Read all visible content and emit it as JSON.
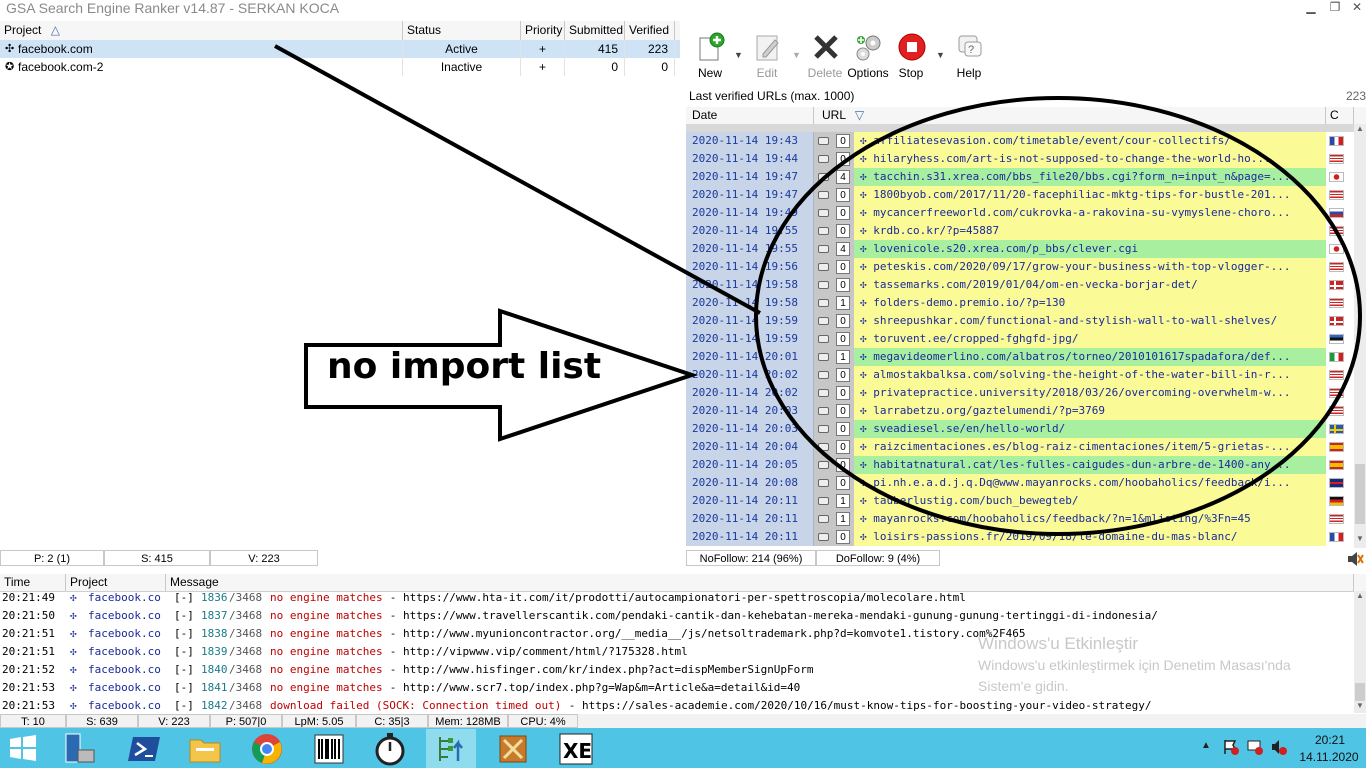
{
  "window": {
    "title": "GSA Search Engine Ranker v14.87 - SERKAN KOCA",
    "min_icon": "minimize-icon",
    "max_icon": "maximize-icon"
  },
  "projects": {
    "headers": {
      "project": "Project",
      "status": "Status",
      "priority": "Priority",
      "submitted": "Submitted",
      "verified": "Verified"
    },
    "rows": [
      {
        "name": "facebook.com",
        "status": "Active",
        "priority": "+",
        "submitted": "415",
        "verified": "223"
      },
      {
        "name": "facebook.com-2",
        "status": "Inactive",
        "priority": "+",
        "submitted": "0",
        "verified": "0"
      }
    ],
    "status_bar": {
      "p": "P: 2 (1)",
      "s": "S: 415",
      "v": "V: 223"
    }
  },
  "toolbar": {
    "new": "New",
    "edit": "Edit",
    "delete": "Delete",
    "options": "Options",
    "stop": "Stop",
    "help": "Help"
  },
  "verified": {
    "caption": "Last verified URLs (max. 1000)",
    "count": "223",
    "headers": {
      "date": "Date",
      "url": "URL",
      "c": "C"
    },
    "rows": [
      {
        "date": "2020-11-14 19:43",
        "n": "0",
        "url": "affiliatesevasion.com/timetable/event/cour-collectifs/",
        "flag": "fr",
        "hl": false
      },
      {
        "date": "2020-11-14 19:44",
        "n": "0",
        "url": "hilaryhess.com/art-is-not-supposed-to-change-the-world-ho...",
        "flag": "us",
        "hl": false
      },
      {
        "date": "2020-11-14 19:47",
        "n": "4",
        "url": "tacchin.s31.xrea.com/bbs_file20/bbs.cgi?form_n=input_n&page=...",
        "flag": "jp",
        "hl": true
      },
      {
        "date": "2020-11-14 19:47",
        "n": "0",
        "url": "1800byob.com/2017/11/20-facephiliac-mktg-tips-for-bustle-201...",
        "flag": "us",
        "hl": false
      },
      {
        "date": "2020-11-14 19:49",
        "n": "0",
        "url": "mycancerfreeworld.com/cukrovka-a-rakovina-su-vymyslene-choro...",
        "flag": "sk",
        "hl": false
      },
      {
        "date": "2020-11-14 19:55",
        "n": "0",
        "url": "krdb.co.kr/?p=45887",
        "flag": "us",
        "hl": false
      },
      {
        "date": "2020-11-14 19:55",
        "n": "4",
        "url": "lovenicole.s20.xrea.com/p_bbs/clever.cgi",
        "flag": "jp",
        "hl": true
      },
      {
        "date": "2020-11-14 19:56",
        "n": "0",
        "url": "peteskis.com/2020/09/17/grow-your-business-with-top-vlogger-...",
        "flag": "us",
        "hl": false
      },
      {
        "date": "2020-11-14 19:58",
        "n": "0",
        "url": "tassemarks.com/2019/01/04/om-en-vecka-borjar-det/",
        "flag": "dk",
        "hl": false
      },
      {
        "date": "2020-11-14 19:58",
        "n": "1",
        "url": "folders-demo.premio.io/?p=130",
        "flag": "us",
        "hl": false
      },
      {
        "date": "2020-11-14 19:59",
        "n": "0",
        "url": "shreepushkar.com/functional-and-stylish-wall-to-wall-shelves/",
        "flag": "dk",
        "hl": false
      },
      {
        "date": "2020-11-14 19:59",
        "n": "0",
        "url": "toruvent.ee/cropped-fghgfd-jpg/",
        "flag": "ee",
        "hl": false
      },
      {
        "date": "2020-11-14 20:01",
        "n": "1",
        "url": "megavideomerlino.com/albatros/torneo/2010101617spadafora/def...",
        "flag": "it",
        "hl": true
      },
      {
        "date": "2020-11-14 20:02",
        "n": "0",
        "url": "almostakbalksa.com/solving-the-height-of-the-water-bill-in-r...",
        "flag": "us",
        "hl": false
      },
      {
        "date": "2020-11-14 20:02",
        "n": "0",
        "url": "privatepractice.university/2018/03/26/overcoming-overwhelm-w...",
        "flag": "us",
        "hl": false
      },
      {
        "date": "2020-11-14 20:03",
        "n": "0",
        "url": "larrabetzu.org/gaztelumendi/?p=3769",
        "flag": "us",
        "hl": false
      },
      {
        "date": "2020-11-14 20:03",
        "n": "0",
        "url": "sveadiesel.se/en/hello-world/",
        "flag": "se",
        "hl": true
      },
      {
        "date": "2020-11-14 20:04",
        "n": "0",
        "url": "raizcimentaciones.es/blog-raiz-cimentaciones/item/5-grietas-...",
        "flag": "es",
        "hl": false
      },
      {
        "date": "2020-11-14 20:05",
        "n": "0",
        "url": "habitatnatural.cat/les-fulles-caigudes-dun-arbre-de-1400-any...",
        "flag": "es",
        "hl": true
      },
      {
        "date": "2020-11-14 20:08",
        "n": "0",
        "url": "pi.nh.e.a.d.j.q.Dq@www.mayanrocks.com/hoobaholics/feedback/i...",
        "flag": "uk",
        "hl": false
      },
      {
        "date": "2020-11-14 20:11",
        "n": "1",
        "url": "tauberlustig.com/buch_bewegteb/",
        "flag": "de",
        "hl": false
      },
      {
        "date": "2020-11-14 20:11",
        "n": "1",
        "url": "mayanrocks.com/hoobaholics/feedback/?n=1&mlisting/%3Fn=45",
        "flag": "us",
        "hl": false
      },
      {
        "date": "2020-11-14 20:11",
        "n": "0",
        "url": "loisirs-passions.fr/2019/09/18/le-domaine-du-mas-blanc/",
        "flag": "fr",
        "hl": false
      }
    ],
    "nofollow": "NoFollow: 214 (96%)",
    "dofollow": "DoFollow: 9 (4%)"
  },
  "annotation": {
    "text": "no import list"
  },
  "log": {
    "headers": {
      "time": "Time",
      "project": "Project",
      "message": "Message"
    },
    "rows": [
      {
        "time": "20:21:49",
        "project": "facebook.co",
        "num": "1836",
        "total": "/3468",
        "kind": "no engine matches",
        "url": "- https://www.hta-it.com/it/prodotti/autocampionatori-per-spettroscopia/molecolare.html"
      },
      {
        "time": "20:21:50",
        "project": "facebook.co",
        "num": "1837",
        "total": "/3468",
        "kind": "no engine matches",
        "url": "- https://www.travellerscantik.com/pendaki-cantik-dan-kehebatan-mereka-mendaki-gunung-gunung-tertinggi-di-indonesia/"
      },
      {
        "time": "20:21:51",
        "project": "facebook.co",
        "num": "1838",
        "total": "/3468",
        "kind": "no engine matches",
        "url": "- http://www.myunioncontractor.org/__media__/js/netsoltrademark.php?d=komvote1.tistory.com%2F465"
      },
      {
        "time": "20:21:51",
        "project": "facebook.co",
        "num": "1839",
        "total": "/3468",
        "kind": "no engine matches",
        "url": "- http://vipwww.vip/comment/html/?175328.html"
      },
      {
        "time": "20:21:52",
        "project": "facebook.co",
        "num": "1840",
        "total": "/3468",
        "kind": "no engine matches",
        "url": "- http://www.hisfinger.com/kr/index.php?act=dispMemberSignUpForm"
      },
      {
        "time": "20:21:53",
        "project": "facebook.co",
        "num": "1841",
        "total": "/3468",
        "kind": "no engine matches",
        "url": "- http://www.scr7.top/index.php?g=Wap&m=Article&a=detail&id=40"
      },
      {
        "time": "20:21:53",
        "project": "facebook.co",
        "num": "1842",
        "total": "/3468",
        "kind": "download failed (SOCK: Connection timed out)",
        "url": "- https://sales-academie.com/2020/10/16/must-know-tips-for-boosting-your-video-strategy/"
      }
    ]
  },
  "status": {
    "t": "T: 10",
    "s": "S: 639",
    "v": "V: 223",
    "p": "P: 507|0",
    "lpm": "LpM: 5.05",
    "c": "C: 35|3",
    "mem": "Mem: 128MB",
    "cpu": "CPU: 4%"
  },
  "watermark": {
    "title": "Windows'u Etkinleştir",
    "line1": "Windows'u etkinleştirmek için Denetim Masası'nda",
    "line2": "Sistem'e gidin."
  },
  "taskbar": {
    "time": "20:21",
    "date": "14.11.2020"
  },
  "colors": {
    "taskbar": "#4fc4e4",
    "yellow_row": "#fafa96",
    "green_row": "#a8f0a0",
    "log_red": "#c00000",
    "log_num": "#1a7a8a"
  }
}
